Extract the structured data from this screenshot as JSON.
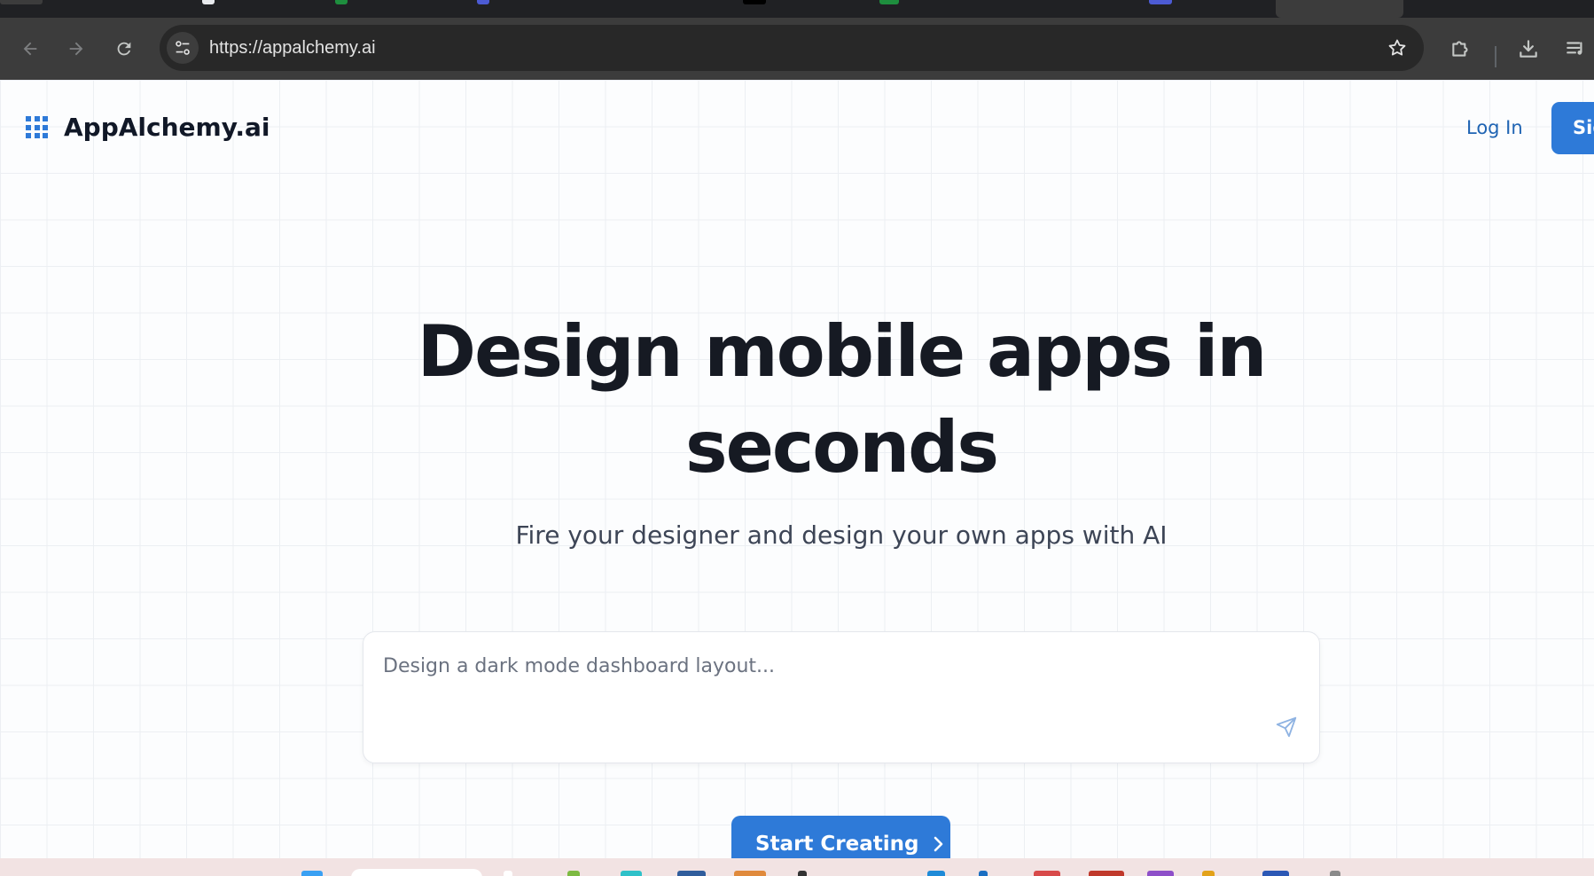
{
  "browser": {
    "url": "https://appalchemy.ai",
    "icons": {
      "back": "arrow-left-icon",
      "forward": "arrow-right-icon",
      "reload": "reload-icon",
      "site_info": "tune-icon",
      "bookmark": "star-icon",
      "extensions": "puzzle-icon",
      "downloads": "download-icon",
      "reading_list": "queue-music-icon"
    }
  },
  "header": {
    "brand": "AppAlchemy.ai",
    "login": "Log In",
    "signup": "Sig"
  },
  "hero": {
    "title_line1": "Design mobile apps in",
    "title_line2": "seconds",
    "subtitle": "Fire your designer and design your own apps with AI"
  },
  "prompt": {
    "placeholder": "Design a dark mode dashboard layout...",
    "value": ""
  },
  "cta": {
    "label": "Start Creating"
  },
  "colors": {
    "primary": "#2e7ad8",
    "heading": "#161a23",
    "subtext": "#3d4556",
    "chrome": "#3c3c3c"
  }
}
